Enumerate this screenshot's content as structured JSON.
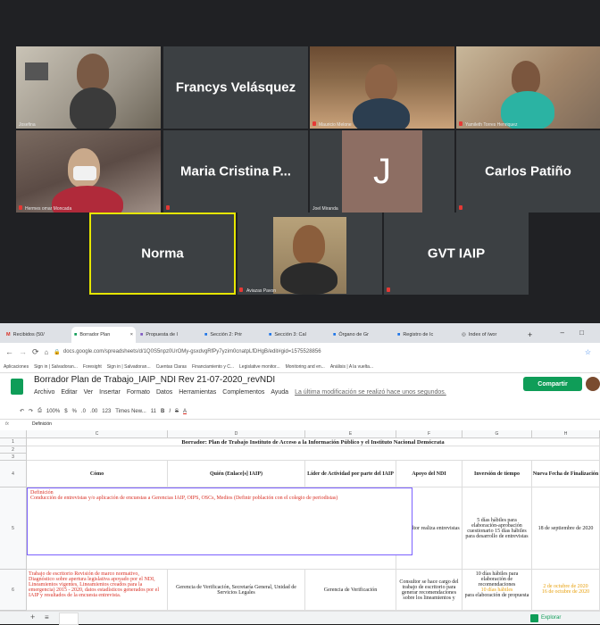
{
  "meet": {
    "tiles": [
      {
        "name": "",
        "label": "Josefina",
        "type": "video"
      },
      {
        "name": "Francys Velásquez",
        "label": "",
        "type": "name"
      },
      {
        "name": "",
        "label": "Mauricio Melone",
        "type": "video"
      },
      {
        "name": "",
        "label": "Yamileth Torres Henriquez",
        "type": "video"
      },
      {
        "name": "",
        "label": "Hermes omar Moncada",
        "type": "video"
      },
      {
        "name": "Maria Cristina P...",
        "label": "",
        "type": "name"
      },
      {
        "name": "J",
        "label": "Joel Miranda",
        "type": "avatar"
      },
      {
        "name": "Carlos Patiño",
        "label": "",
        "type": "name"
      },
      {
        "name": "Norma",
        "label": "",
        "type": "name"
      },
      {
        "name": "",
        "label": "Aviazas Pavon",
        "type": "video"
      },
      {
        "name": "GVT IAIP",
        "label": "",
        "type": "name"
      }
    ]
  },
  "browser": {
    "tabs": [
      {
        "icon": "M",
        "label": "Recibidos (50/"
      },
      {
        "icon": "■",
        "label": "Borrador Plan"
      },
      {
        "icon": "■",
        "label": "Propuesta de l"
      },
      {
        "icon": "■",
        "label": "Sección 2: Prir"
      },
      {
        "icon": "■",
        "label": "Sección 3: Cal"
      },
      {
        "icon": "■",
        "label": "Órgano de Gr"
      },
      {
        "icon": "■",
        "label": "Registro de Ic"
      },
      {
        "icon": "◎",
        "label": "Index of /wor"
      }
    ],
    "new_tab": "+",
    "url": "docs.google.com/spreadsheets/d/1Q0S5npz0UrOMy-gsxdvgRfPy7yzim0cnatpLfDHgB/edit#gid=1575528856",
    "bookmarks": [
      "Aplicaciones",
      "Sign in | Salvadoran...",
      "Foresight",
      "Sign in | Salvadoran...",
      "Cuentas Claras",
      "Financiamiento y C...",
      "Legislative monitor...",
      "Monitoring and en...",
      "Análisis | A la vuelta..."
    ]
  },
  "sheet": {
    "title": "Borrador Plan de Trabajo_IAIP_NDI Rev 21-07-2020_revNDI",
    "menu": [
      "Archivo",
      "Editar",
      "Ver",
      "Insertar",
      "Formato",
      "Datos",
      "Herramientas",
      "Complementos",
      "Ayuda"
    ],
    "last_edit": "La última modificación se realizó hace unos segundos.",
    "share": "Compartir",
    "toolbar": [
      "100%",
      "$",
      "%",
      ".0",
      ".00",
      "123",
      "Times New...",
      "11",
      "B",
      "I",
      "S",
      "A"
    ],
    "formula": "Definición",
    "col_letters": [
      "C",
      "D",
      "E",
      "F",
      "G",
      "H"
    ],
    "row_numbers": [
      "1",
      "2",
      "3",
      "4",
      "5",
      "6"
    ],
    "banner": "Borrador: Plan de Trabajo Instituto de Acceso a la Información Público y el Instituto Nacional Demócrata",
    "headers": [
      "Cómo",
      "Quién (Enlace[s] IAIP)",
      "Líder de Actividad por parte del IAIP",
      "Apoyo del NDI",
      "Inversión de tiempo",
      "Nueva Fecha de Finalización"
    ],
    "row5": {
      "c1": "Definición",
      "c2": "Conducción de entrevistas y/o aplicación de encuestas a Gerencias IAIP, OIPS, OSCs, Medios (Definir población con el colegio de periodistas)",
      "f": "Consultor realiza entrevistas",
      "g": "5 días hábiles para elaboración-aprobación cuestionario 15 días hábiles para desarrollo de entrevistas",
      "h": "18 de septiembre de 2020"
    },
    "row6": {
      "c": "Trabajo de escritorio Revisión de marco normativo, Diagnóstico sobre apertura legislativa apoyado por el NDI, Lineamientos vigentes, Lineamientos creados para la emergencia) 2015 - 2020, datos estadísticos generados por el IAIP y resultados de la encuesta entrevista.",
      "d": "Gerencia de Verificación, Secretaría General, Unidad de Servicios Legales",
      "e": "Gerencia de Verificación",
      "f": "Consultor se hace cargo del trabajo de escritorio para generar recomendaciones sobre los lineamientos y",
      "g1": "10 días hábiles para elaboración de recomendaciones",
      "g2": "10 días hábiles",
      "g3": "para elaboración de propuesta",
      "h1": "2 de octubre de 2020",
      "h2": "16 de octubre de 2020"
    },
    "sheet_tab_add": "+",
    "explore": "Explorar"
  },
  "colors": {
    "accent": "#0f9d58",
    "red": "#d93025",
    "yellow_border": "#e6e600",
    "avatar": "#8d6e63"
  }
}
